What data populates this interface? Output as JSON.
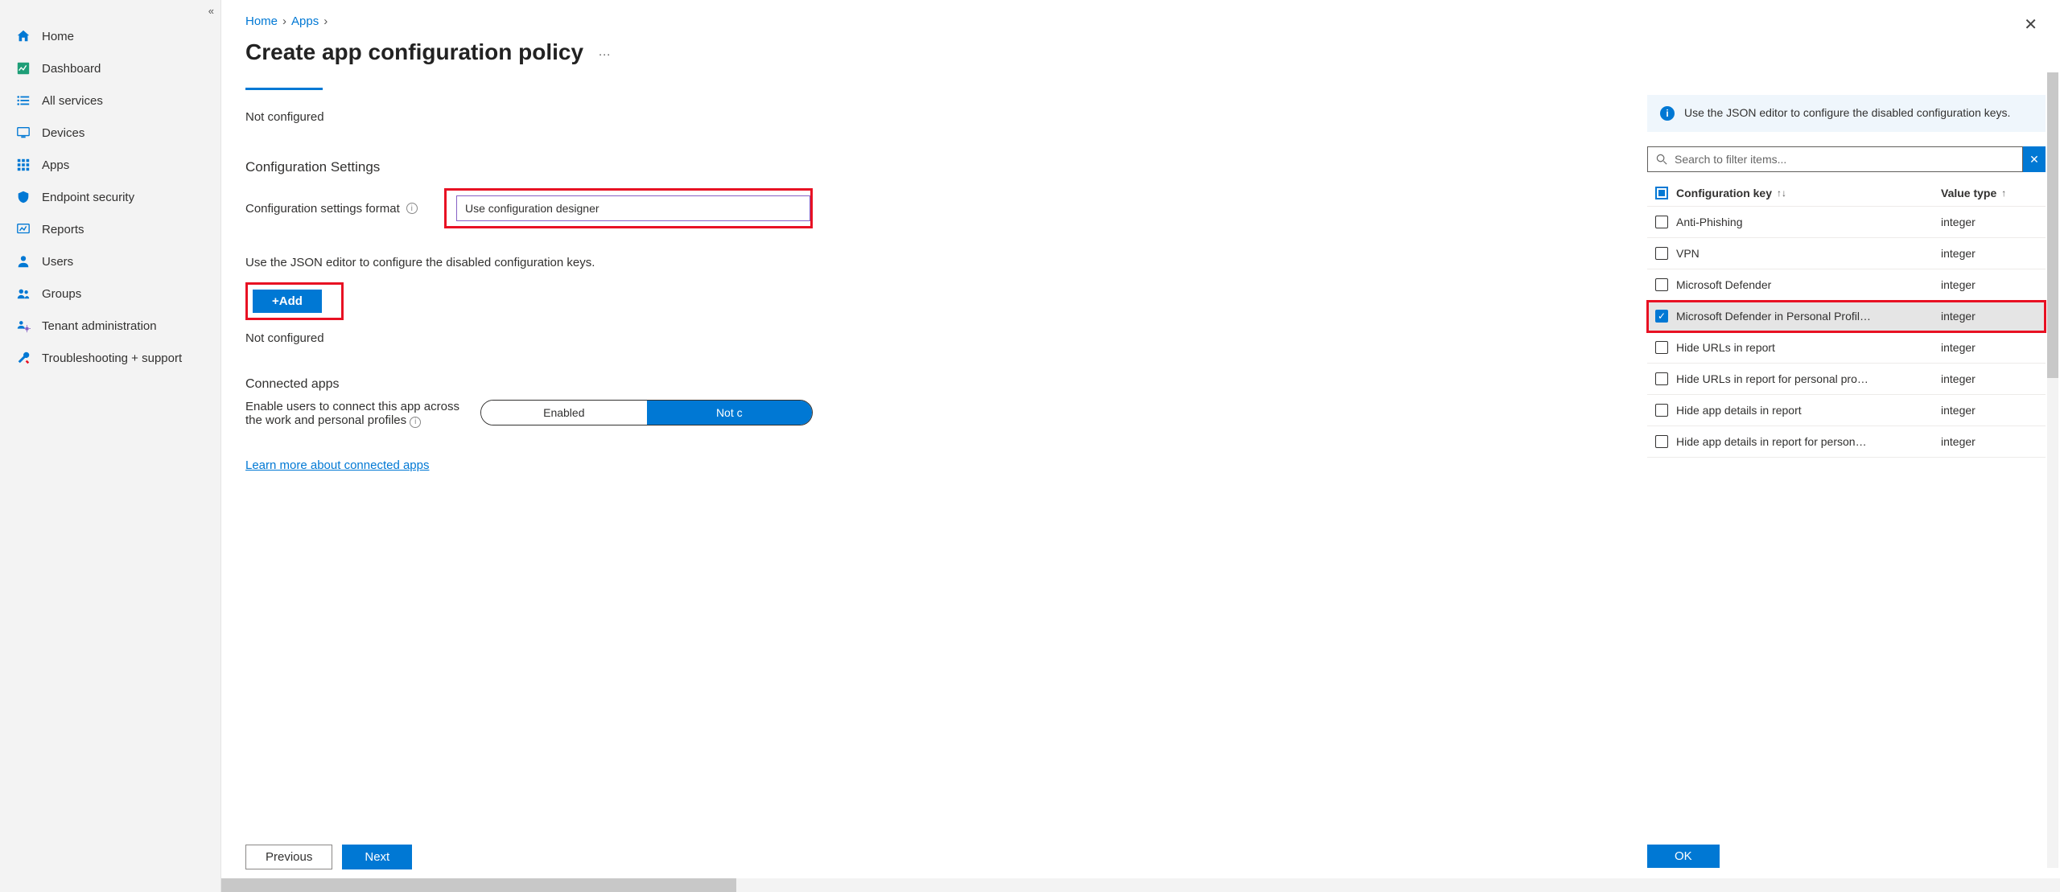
{
  "sidebar": {
    "items": [
      {
        "label": "Home",
        "icon": "home",
        "color": "#0078d4"
      },
      {
        "label": "Dashboard",
        "icon": "dashboard",
        "color": "#1e9e77"
      },
      {
        "label": "All services",
        "icon": "list",
        "color": "#0078d4"
      },
      {
        "label": "Devices",
        "icon": "monitor",
        "color": "#0078d4"
      },
      {
        "label": "Apps",
        "icon": "grid",
        "color": "#0078d4"
      },
      {
        "label": "Endpoint security",
        "icon": "shield",
        "color": "#0078d4"
      },
      {
        "label": "Reports",
        "icon": "report",
        "color": "#0078d4"
      },
      {
        "label": "Users",
        "icon": "user",
        "color": "#0078d4"
      },
      {
        "label": "Groups",
        "icon": "users",
        "color": "#0078d4"
      },
      {
        "label": "Tenant administration",
        "icon": "tenant",
        "color": "#0078d4"
      },
      {
        "label": "Troubleshooting + support",
        "icon": "wrench",
        "color": "#0078d4"
      }
    ]
  },
  "breadcrumb": {
    "home": "Home",
    "apps": "Apps"
  },
  "page": {
    "title": "Create app configuration policy",
    "not_configured": "Not configured",
    "section_settings": "Configuration Settings",
    "format_label": "Configuration settings format",
    "format_value": "Use configuration designer",
    "json_note": "Use the JSON editor to configure the disabled configuration keys.",
    "add_btn": "+Add",
    "not_configured2": "Not configured",
    "connected_title": "Connected apps",
    "connected_desc": "Enable users to connect this app across the work and personal profiles",
    "toggle_enabled": "Enabled",
    "toggle_notconf": "Not c",
    "link": "Learn more about connected apps",
    "prev_btn": "Previous",
    "next_btn": "Next"
  },
  "panel": {
    "info_text": "Use the JSON editor to configure the disabled configuration keys.",
    "search_placeholder": "Search to filter items...",
    "col_key": "Configuration key",
    "col_val": "Value type",
    "rows": [
      {
        "key": "Anti-Phishing",
        "val": "integer",
        "checked": false
      },
      {
        "key": "VPN",
        "val": "integer",
        "checked": false
      },
      {
        "key": "Microsoft Defender",
        "val": "integer",
        "checked": false
      },
      {
        "key": "Microsoft Defender in Personal Profil…",
        "val": "integer",
        "checked": true,
        "highlighted": true
      },
      {
        "key": "Hide URLs in report",
        "val": "integer",
        "checked": false
      },
      {
        "key": "Hide URLs in report for personal pro…",
        "val": "integer",
        "checked": false
      },
      {
        "key": "Hide app details in report",
        "val": "integer",
        "checked": false
      },
      {
        "key": "Hide app details in report for person…",
        "val": "integer",
        "checked": false
      }
    ],
    "ok_btn": "OK"
  }
}
